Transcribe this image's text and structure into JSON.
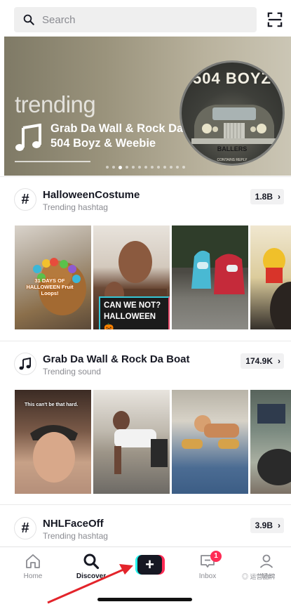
{
  "search": {
    "placeholder": "Search"
  },
  "banner": {
    "label": "trending",
    "song": "Grab Da Wall & Rock Da Boat",
    "artist": "504 Boyz & Weebie",
    "disc_title": "504 BOYZ",
    "plate": "BALLERS",
    "disc_sub": "CONTAINS REPLY",
    "slides": 13,
    "active_slide": 3
  },
  "sections": [
    {
      "icon": "#",
      "title": "HalloweenCostume",
      "subtitle": "Trending hashtag",
      "count": "1.8B",
      "captions": {
        "days": "31 DAYS OF HALLOWEEN Fruit Loops!",
        "overlay": "CAN WE NOT? HALLOWEEN 🎃"
      }
    },
    {
      "icon": "music-note-icon",
      "title": "Grab Da Wall & Rock Da Boat",
      "subtitle": "Trending sound",
      "count": "174.9K",
      "captions": {
        "overlay": "This can't be that hard."
      }
    },
    {
      "icon": "#",
      "title": "NHLFaceOff",
      "subtitle": "Trending hashtag",
      "count": "3.9B"
    }
  ],
  "nav": {
    "home": "Home",
    "discover": "Discover",
    "create": "+",
    "inbox": "Inbox",
    "inbox_badge": "1",
    "me": "Me"
  },
  "watermark": "◎ 运营品牌",
  "colors": {
    "accent_red": "#fe2c55",
    "accent_cyan": "#25f4ee",
    "text": "#161823",
    "muted": "#8a8b91"
  }
}
